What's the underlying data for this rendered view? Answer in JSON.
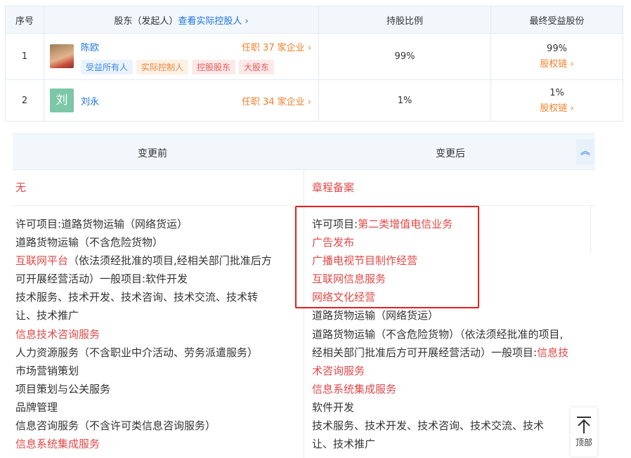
{
  "shareholders": {
    "headers": {
      "index": "序号",
      "holder": "股东（发起人）",
      "holder_link": "查看实际控股人",
      "ratio": "持股比例",
      "benefit": "最终受益股份"
    },
    "rows": [
      {
        "index": "1",
        "name": "陈欧",
        "positions": "任职 37 家企业",
        "tags": [
          "受益所有人",
          "实际控制人",
          "控股股东",
          "大股东"
        ],
        "ratio": "99%",
        "benefit": "99%",
        "benefit_link": "股权链"
      },
      {
        "index": "2",
        "avatar_char": "刘",
        "name": "刘永",
        "positions": "任职 34 家企业",
        "ratio": "1%",
        "benefit": "1%",
        "benefit_link": "股权链"
      }
    ]
  },
  "changes": {
    "before_header": "变更前",
    "after_header": "变更后",
    "row1": {
      "before": "无",
      "after": "章程备案"
    },
    "before_lines": [
      {
        "prefix": "许可项目:道路货物运输（网络货运）"
      },
      {
        "prefix": "道路货物运输（不含危险货物）"
      },
      {
        "red": "互联网平台",
        "suffix": "（依法须经批准的项目,经相关部门批准后方"
      },
      {
        "prefix": "可开展经营活动）一般项目:软件开发"
      },
      {
        "prefix": "技术服务、技术开发、技术咨询、技术交流、技术转"
      },
      {
        "prefix": "让、技术推广"
      },
      {
        "red": "信息技术咨询服务"
      },
      {
        "prefix": "人力资源服务（不含职业中介活动、劳务派遣服务）"
      },
      {
        "prefix": "市场营销策划"
      },
      {
        "prefix": "项目策划与公关服务"
      },
      {
        "prefix": "品牌管理"
      },
      {
        "prefix": "信息咨询服务（不含许可类信息咨询服务）"
      },
      {
        "red": "信息系统集成服务"
      }
    ],
    "after_lines": [
      {
        "prefix": "许可项目:",
        "red": "第二类增值电信业务"
      },
      {
        "red": "广告发布"
      },
      {
        "red": "广播电视节目制作经营"
      },
      {
        "red": "互联网信息服务"
      },
      {
        "red": "网络文化经营"
      },
      {
        "prefix": "道路货物运输（网络货运）"
      },
      {
        "prefix": "道路货物运输（不含危险货物）（依法须经批准的项目,"
      },
      {
        "prefix": "经相关部门批准后方可开展经营活动）一般项目:",
        "red": "信息技"
      },
      {
        "red": "术咨询服务"
      },
      {
        "red": "信息系统集成服务"
      },
      {
        "prefix": "软件开发"
      },
      {
        "prefix": "技术服务、技术开发、技术咨询、技术交流、技术"
      },
      {
        "prefix": "让、技术推广"
      }
    ]
  },
  "to_top": {
    "label": "顶部",
    "icon": "arrow-up-icon"
  },
  "colors": {
    "accent": "#1a73d9",
    "orange": "#f07f2b",
    "red": "#e14848",
    "highlight_box": "#e02020"
  }
}
